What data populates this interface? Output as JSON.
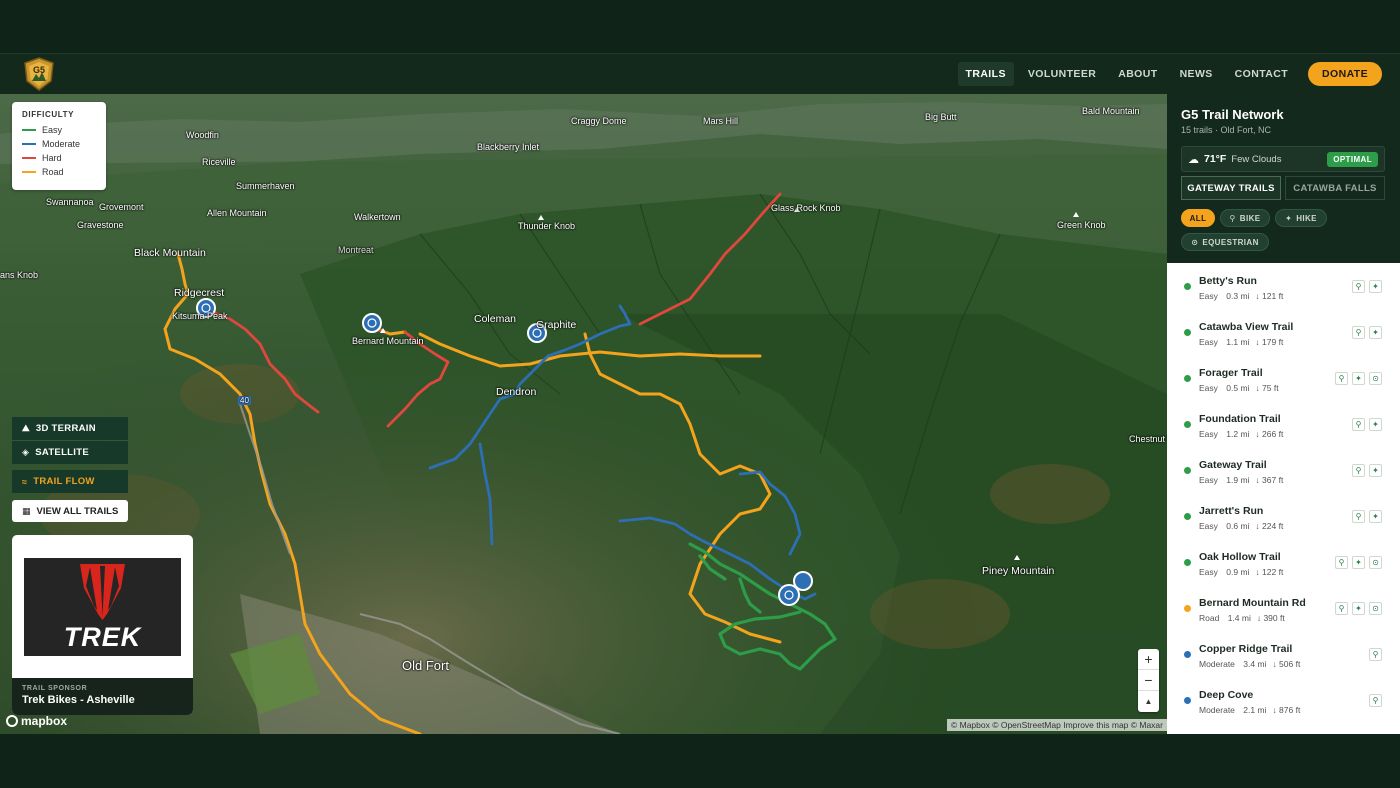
{
  "nav": {
    "logo_text": "G5",
    "items": [
      "TRAILS",
      "VOLUNTEER",
      "ABOUT",
      "NEWS",
      "CONTACT"
    ],
    "donate": "DONATE"
  },
  "legend": {
    "title": "DIFFICULTY",
    "items": [
      {
        "label": "Easy",
        "color": "#2e9d4a"
      },
      {
        "label": "Moderate",
        "color": "#2d6fb5"
      },
      {
        "label": "Hard",
        "color": "#e0483e"
      },
      {
        "label": "Road",
        "color": "#f4a31d"
      }
    ]
  },
  "map_controls": {
    "terrain": "3D TERRAIN",
    "satellite": "SATELLITE",
    "trail_flow": "TRAIL FLOW",
    "view_all": "VIEW ALL TRAILS"
  },
  "sponsor": {
    "label": "TRAIL SPONSOR",
    "name": "Trek Bikes - Asheville",
    "logo_text": "TREK"
  },
  "map_labels": {
    "black_mountain": "Black Mountain",
    "ridgecrest": "Ridgecrest",
    "kitsuma": "Kitsuma Peak",
    "bernard": "Bernard Mountain",
    "coleman": "Coleman",
    "graphite": "Graphite",
    "dendron": "Dendron",
    "old_fort": "Old Fort",
    "piney": "Piney Mountain",
    "chestnut": "Chestnut Mount",
    "thunder": "Thunder Knob",
    "glass_rock": "Glass Rock Knob",
    "green_knob": "Green Knob",
    "walkertown": "Walkertown",
    "montreat": "Montreat",
    "swannanoa": "Swannanoa",
    "grovemont": "Grovemont",
    "gravestone": "Gravestone",
    "summerhaven": "Summerhaven",
    "allen": "Allen Mountain",
    "woodfin": "Woodfin",
    "riceville": "Riceville",
    "blackberry": "Blackberry Inlet",
    "craggy": "Craggy Dome",
    "mars_hill": "Mars Hill",
    "big_butt": "Big Butt",
    "bald": "Bald Mountain",
    "ans_knob": "ans Knob",
    "i40": "40"
  },
  "attribution": "© Mapbox © OpenStreetMap  Improve this map © Maxar",
  "mapbox": "mapbox",
  "zoom": {
    "in": "+",
    "out": "−",
    "compass": "▲"
  },
  "panel": {
    "title": "G5 Trail Network",
    "subtitle": "15 trails · Old Fort, NC",
    "weather": {
      "temp": "71°F",
      "desc": "Few Clouds",
      "badge": "OPTIMAL"
    },
    "tabs": [
      "GATEWAY TRAILS",
      "CATAWBA FALLS"
    ],
    "filters": [
      "ALL",
      "BIKE",
      "HIKE",
      "EQUESTRIAN"
    ],
    "trails": [
      {
        "name": "Betty's Run",
        "difficulty": "Easy",
        "distance": "0.3 mi",
        "elevation": "121 ft",
        "color": "#2e9d4a",
        "icons": [
          "bike-icon",
          "hike-icon"
        ]
      },
      {
        "name": "Catawba View Trail",
        "difficulty": "Easy",
        "distance": "1.1 mi",
        "elevation": "179 ft",
        "color": "#2e9d4a",
        "icons": [
          "bike-icon",
          "hike-icon"
        ]
      },
      {
        "name": "Forager Trail",
        "difficulty": "Easy",
        "distance": "0.5 mi",
        "elevation": "75 ft",
        "color": "#2e9d4a",
        "icons": [
          "bike-icon",
          "hike-icon",
          "horse-icon"
        ]
      },
      {
        "name": "Foundation Trail",
        "difficulty": "Easy",
        "distance": "1.2 mi",
        "elevation": "266 ft",
        "color": "#2e9d4a",
        "icons": [
          "bike-icon",
          "hike-icon"
        ]
      },
      {
        "name": "Gateway Trail",
        "difficulty": "Easy",
        "distance": "1.9 mi",
        "elevation": "367 ft",
        "color": "#2e9d4a",
        "icons": [
          "bike-icon",
          "hike-icon"
        ]
      },
      {
        "name": "Jarrett's Run",
        "difficulty": "Easy",
        "distance": "0.6 mi",
        "elevation": "224 ft",
        "color": "#2e9d4a",
        "icons": [
          "bike-icon",
          "hike-icon"
        ]
      },
      {
        "name": "Oak Hollow Trail",
        "difficulty": "Easy",
        "distance": "0.9 mi",
        "elevation": "122 ft",
        "color": "#2e9d4a",
        "icons": [
          "bike-icon",
          "hike-icon",
          "horse-icon"
        ]
      },
      {
        "name": "Bernard Mountain Rd",
        "difficulty": "Road",
        "distance": "1.4 mi",
        "elevation": "390 ft",
        "color": "#f4a31d",
        "icons": [
          "bike-icon",
          "hike-icon",
          "horse-icon"
        ]
      },
      {
        "name": "Copper Ridge Trail",
        "difficulty": "Moderate",
        "distance": "3.4 mi",
        "elevation": "506 ft",
        "color": "#2d6fb5",
        "icons": [
          "bike-icon"
        ]
      },
      {
        "name": "Deep Cove",
        "difficulty": "Moderate",
        "distance": "2.1 mi",
        "elevation": "876 ft",
        "color": "#2d6fb5",
        "icons": [
          "bike-icon"
        ]
      }
    ]
  }
}
